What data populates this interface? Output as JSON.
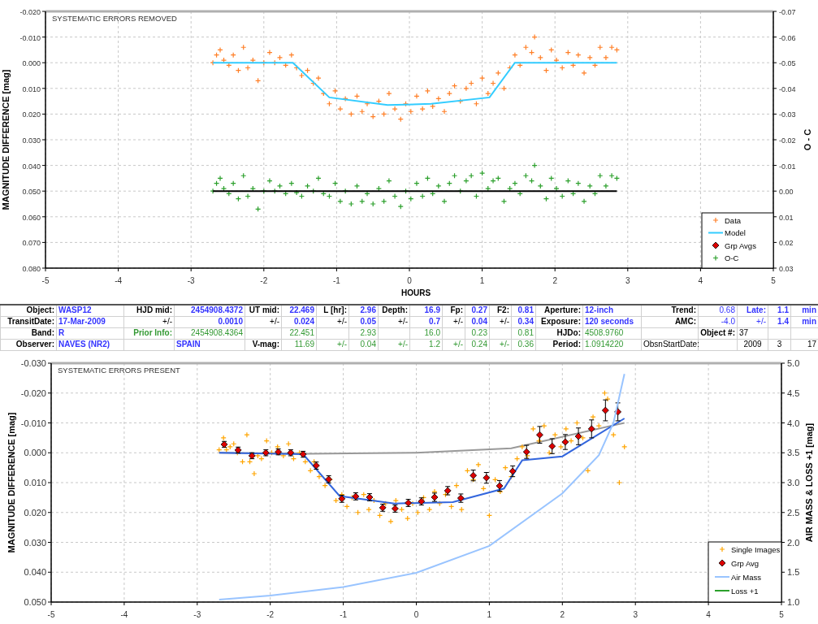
{
  "top_chart": {
    "chart_data": {
      "type": "scatter",
      "title": "SYSTEMATIC ERRORS REMOVED",
      "xlabel": "HOURS",
      "ylabel": "MAGNITUDE DIFFERENCE [mag]",
      "y2label": "O - C",
      "xlim": [
        -5,
        5
      ],
      "ylim": [
        0.08,
        -0.02
      ],
      "y2lim": [
        0.03,
        -0.07
      ],
      "grid": true,
      "legend": true,
      "xticks": [
        {
          "value": -5,
          "label": "-5"
        },
        {
          "value": -4,
          "label": "-4"
        },
        {
          "value": -3,
          "label": "-3"
        },
        {
          "value": -2,
          "label": "-2"
        },
        {
          "value": -1,
          "label": "-1"
        },
        {
          "value": 0,
          "label": "0"
        },
        {
          "value": 1,
          "label": "1"
        },
        {
          "value": 2,
          "label": "2"
        },
        {
          "value": 3,
          "label": "3"
        },
        {
          "value": 4,
          "label": "4"
        },
        {
          "value": 5,
          "label": "5"
        }
      ],
      "yticks": [
        {
          "value": -0.02,
          "label": "-0.020"
        },
        {
          "value": -0.01,
          "label": "-0.010"
        },
        {
          "value": 0,
          "label": "0.000"
        },
        {
          "value": 0.01,
          "label": "0.010"
        },
        {
          "value": 0.02,
          "label": "0.020"
        },
        {
          "value": 0.03,
          "label": "0.030"
        },
        {
          "value": 0.04,
          "label": "0.040"
        },
        {
          "value": 0.05,
          "label": "0.050"
        },
        {
          "value": 0.06,
          "label": "0.060"
        },
        {
          "value": 0.07,
          "label": "0.070"
        },
        {
          "value": 0.08,
          "label": "0.080"
        }
      ],
      "y2ticks": [
        {
          "value": -0.07,
          "label": "-0.07"
        },
        {
          "value": -0.06,
          "label": "-0.06"
        },
        {
          "value": -0.05,
          "label": "-0.05"
        },
        {
          "value": -0.04,
          "label": "-0.04"
        },
        {
          "value": -0.03,
          "label": "-0.03"
        },
        {
          "value": -0.02,
          "label": "-0.02"
        },
        {
          "value": -0.01,
          "label": "-0.01"
        },
        {
          "value": 0,
          "label": "0.00"
        },
        {
          "value": 0.01,
          "label": "0.01"
        },
        {
          "value": 0.02,
          "label": "0.02"
        },
        {
          "value": 0.03,
          "label": "0.03"
        }
      ],
      "series": [
        {
          "name": "Data",
          "type": "scatter",
          "marker": "plus",
          "color": "#ff7f27",
          "x": [
            -2.7,
            -2.65,
            -2.6,
            -2.55,
            -2.48,
            -2.42,
            -2.35,
            -2.28,
            -2.22,
            -2.15,
            -2.08,
            -2.0,
            -1.92,
            -1.85,
            -1.78,
            -1.7,
            -1.62,
            -1.55,
            -1.48,
            -1.4,
            -1.32,
            -1.25,
            -1.18,
            -1.1,
            -1.02,
            -0.95,
            -0.88,
            -0.8,
            -0.72,
            -0.65,
            -0.58,
            -0.5,
            -0.42,
            -0.35,
            -0.28,
            -0.2,
            -0.12,
            -0.05,
            0.02,
            0.1,
            0.18,
            0.25,
            0.32,
            0.4,
            0.48,
            0.55,
            0.62,
            0.7,
            0.78,
            0.85,
            0.92,
            1.0,
            1.08,
            1.15,
            1.22,
            1.3,
            1.38,
            1.45,
            1.52,
            1.6,
            1.68,
            1.72,
            1.8,
            1.88,
            1.95,
            2.02,
            2.1,
            2.18,
            2.25,
            2.32,
            2.4,
            2.48,
            2.55,
            2.62,
            2.7,
            2.78,
            2.85
          ],
          "values": [
            0.0,
            -0.003,
            -0.005,
            -0.001,
            0.001,
            -0.003,
            0.003,
            -0.006,
            0.002,
            -0.001,
            0.007,
            0.0,
            -0.004,
            0.0,
            -0.002,
            0.001,
            -0.003,
            0.002,
            0.005,
            0.003,
            0.008,
            0.006,
            0.012,
            0.016,
            0.011,
            0.018,
            0.014,
            0.02,
            0.013,
            0.019,
            0.016,
            0.021,
            0.015,
            0.02,
            0.012,
            0.018,
            0.022,
            0.016,
            0.019,
            0.013,
            0.018,
            0.011,
            0.017,
            0.014,
            0.019,
            0.012,
            0.009,
            0.015,
            0.01,
            0.008,
            0.016,
            0.006,
            0.012,
            0.008,
            0.004,
            0.01,
            0.002,
            -0.003,
            0.001,
            -0.006,
            -0.004,
            -0.01,
            -0.002,
            0.003,
            -0.005,
            -0.001,
            0.002,
            -0.004,
            0.001,
            -0.003,
            0.004,
            -0.002,
            0.001,
            -0.006,
            -0.002,
            -0.006,
            -0.005
          ]
        },
        {
          "name": "Model",
          "type": "line",
          "color": "#33ccff",
          "x": [
            -2.7,
            -1.6,
            -1.1,
            -0.3,
            0.3,
            1.1,
            1.45,
            2.85
          ],
          "values": [
            0,
            0,
            0.0135,
            0.0165,
            0.016,
            0.0135,
            0,
            0
          ]
        },
        {
          "name": "Grp Avgs",
          "type": "scatter",
          "marker": "diamond",
          "color": "#dd0000"
        },
        {
          "name": "O-C",
          "type": "scatter",
          "marker": "plus",
          "color": "#2ca02c",
          "axis": "y2",
          "x": [
            -2.7,
            -2.65,
            -2.6,
            -2.55,
            -2.48,
            -2.42,
            -2.35,
            -2.28,
            -2.22,
            -2.15,
            -2.08,
            -2.0,
            -1.92,
            -1.85,
            -1.78,
            -1.7,
            -1.62,
            -1.55,
            -1.48,
            -1.4,
            -1.32,
            -1.25,
            -1.18,
            -1.1,
            -1.02,
            -0.95,
            -0.88,
            -0.8,
            -0.72,
            -0.65,
            -0.58,
            -0.5,
            -0.42,
            -0.35,
            -0.28,
            -0.2,
            -0.12,
            -0.05,
            0.02,
            0.1,
            0.18,
            0.25,
            0.32,
            0.4,
            0.48,
            0.55,
            0.62,
            0.7,
            0.78,
            0.85,
            0.92,
            1.0,
            1.08,
            1.15,
            1.22,
            1.3,
            1.38,
            1.45,
            1.52,
            1.6,
            1.68,
            1.72,
            1.8,
            1.88,
            1.95,
            2.02,
            2.1,
            2.18,
            2.25,
            2.32,
            2.4,
            2.48,
            2.55,
            2.62,
            2.7,
            2.78,
            2.85
          ],
          "values": [
            0.0,
            -0.003,
            -0.005,
            -0.001,
            0.001,
            -0.003,
            0.003,
            -0.006,
            0.002,
            -0.001,
            0.007,
            0.0,
            -0.004,
            0.0,
            -0.002,
            0.001,
            -0.003,
            0.0006,
            0.002,
            -0.002,
            0.0,
            -0.005,
            0.001,
            0.002,
            -0.003,
            0.004,
            0.0,
            0.005,
            -0.002,
            0.004,
            0.001,
            0.005,
            -0.001,
            0.004,
            -0.004,
            0.002,
            0.006,
            0.0,
            0.003,
            -0.003,
            0.002,
            -0.005,
            0.001,
            -0.002,
            0.004,
            -0.003,
            -0.006,
            0.0,
            -0.004,
            -0.006,
            0.002,
            -0.007,
            -0.001,
            -0.004,
            -0.005,
            0.004,
            -0.001,
            -0.003,
            0.001,
            -0.006,
            -0.004,
            -0.01,
            -0.002,
            0.003,
            -0.005,
            -0.001,
            0.002,
            -0.004,
            0.001,
            -0.003,
            0.004,
            -0.002,
            0.001,
            -0.006,
            -0.002,
            -0.006,
            -0.005
          ]
        },
        {
          "type": "line",
          "color": "#000000",
          "axis": "y2",
          "x": [
            -2.7,
            2.85
          ],
          "values": [
            0,
            0
          ]
        }
      ]
    }
  },
  "parameters_table": {
    "rows": [
      [
        {
          "text": "Object:",
          "kind": "label"
        },
        {
          "text": "WASP12",
          "kind": "text"
        },
        {
          "text": "HJD mid:",
          "kind": "label"
        },
        {
          "text": "2454908.4372",
          "kind": "number"
        },
        {
          "text": "UT mid:",
          "kind": "label"
        },
        {
          "text": "22.469",
          "kind": "number"
        },
        {
          "text": "L [hr]:",
          "kind": "label"
        },
        {
          "text": "2.96",
          "kind": "number"
        },
        {
          "text": "Depth:",
          "kind": "label"
        },
        {
          "text": "16.9",
          "kind": "number"
        },
        {
          "text": "Fp:",
          "kind": "label"
        },
        {
          "text": "0.27",
          "kind": "number"
        },
        {
          "text": "F2:",
          "kind": "label"
        },
        {
          "text": "0.81",
          "kind": "number"
        },
        {
          "text": "Aperture:",
          "kind": "label"
        },
        {
          "text": "12-inch",
          "kind": "text"
        },
        {
          "text": "Trend:",
          "kind": "label"
        },
        {
          "text": "0.68",
          "kind": "number-plain"
        },
        {
          "text": "Late:",
          "kind": "number"
        },
        {
          "text": "1.1",
          "kind": "number"
        },
        {
          "text": "min",
          "kind": "number"
        }
      ],
      [
        {
          "text": "TransitDate:",
          "kind": "label"
        },
        {
          "text": "17-Mar-2009",
          "kind": "text"
        },
        {
          "text": "+/-",
          "kind": "plain"
        },
        {
          "text": "0.0010",
          "kind": "number"
        },
        {
          "text": "+/-",
          "kind": "plain"
        },
        {
          "text": "0.024",
          "kind": "number"
        },
        {
          "text": "+/-",
          "kind": "plain"
        },
        {
          "text": "0.05",
          "kind": "number"
        },
        {
          "text": "+/-",
          "kind": "plain"
        },
        {
          "text": "0.7",
          "kind": "number"
        },
        {
          "text": "+/-",
          "kind": "plain"
        },
        {
          "text": "0.04",
          "kind": "number"
        },
        {
          "text": "+/-",
          "kind": "plain"
        },
        {
          "text": "0.34",
          "kind": "number"
        },
        {
          "text": "Exposure:",
          "kind": "label"
        },
        {
          "text": "120 seconds",
          "kind": "text"
        },
        {
          "text": "AMC:",
          "kind": "label"
        },
        {
          "text": "-4.0",
          "kind": "number-plain"
        },
        {
          "text": "+/-",
          "kind": "number-plain"
        },
        {
          "text": "1.4",
          "kind": "number"
        },
        {
          "text": "min",
          "kind": "number"
        }
      ],
      [
        {
          "text": "Band:",
          "kind": "label"
        },
        {
          "text": "R",
          "kind": "text"
        },
        {
          "text": "Prior Info:",
          "kind": "prior-label"
        },
        {
          "text": "2454908.4364",
          "kind": "prior"
        },
        null,
        {
          "text": "22.451",
          "kind": "prior"
        },
        null,
        {
          "text": "2.93",
          "kind": "prior"
        },
        null,
        {
          "text": "16.0",
          "kind": "prior"
        },
        null,
        {
          "text": "0.23",
          "kind": "prior"
        },
        null,
        {
          "text": "0.81",
          "kind": "prior"
        },
        {
          "text": "HJDo:",
          "kind": "label"
        },
        {
          "text": "4508.9760",
          "kind": "prior-text"
        },
        null,
        {
          "text": "Object #:",
          "kind": "label"
        },
        {
          "text": "37",
          "kind": "plain-text"
        },
        null,
        null
      ],
      [
        {
          "text": "Observer:",
          "kind": "label"
        },
        {
          "text": "NAVES (NR2)",
          "kind": "text"
        },
        null,
        {
          "text": "SPAIN",
          "kind": "text"
        },
        {
          "text": "V-mag:",
          "kind": "label"
        },
        {
          "text": "11.69",
          "kind": "prior"
        },
        {
          "text": "+/-",
          "kind": "prior"
        },
        {
          "text": "0.04",
          "kind": "prior"
        },
        {
          "text": "+/-",
          "kind": "prior"
        },
        {
          "text": "1.2",
          "kind": "prior"
        },
        {
          "text": "+/-",
          "kind": "prior"
        },
        {
          "text": "0.24",
          "kind": "prior"
        },
        {
          "text": "+/-",
          "kind": "prior"
        },
        {
          "text": "0.36",
          "kind": "prior"
        },
        {
          "text": "Period:",
          "kind": "label"
        },
        {
          "text": "1.0914220",
          "kind": "prior-text"
        },
        {
          "text": "ObsnStartDate:",
          "kind": "plain"
        },
        null,
        {
          "text": "2009",
          "kind": "plain-center"
        },
        {
          "text": "3",
          "kind": "plain-center"
        },
        {
          "text": "17",
          "kind": "plain"
        }
      ]
    ]
  },
  "bottom_chart": {
    "chart_data": {
      "type": "scatter",
      "title": "SYSTEMATIC ERRORS PRESENT",
      "ylabel": "MAGNITUDE DIFFERENCE [mag]",
      "y2label": "AIR MASS & LOSS +1 [mag]",
      "xlim": [
        -5,
        5
      ],
      "ylim": [
        0.05,
        -0.03
      ],
      "y2lim": [
        1,
        5
      ],
      "grid": true,
      "legend": true,
      "xticks": [
        {
          "value": -5,
          "label": "-5"
        },
        {
          "value": -4,
          "label": "-4"
        },
        {
          "value": -3,
          "label": "-3"
        },
        {
          "value": -2,
          "label": "-2"
        },
        {
          "value": -1,
          "label": "-1"
        },
        {
          "value": 0,
          "label": "0"
        },
        {
          "value": 1,
          "label": "1"
        },
        {
          "value": 2,
          "label": "2"
        },
        {
          "value": 3,
          "label": "3"
        },
        {
          "value": 4,
          "label": "4"
        },
        {
          "value": 5,
          "label": "5"
        }
      ],
      "yticks": [
        {
          "value": -0.03,
          "label": "-0.030"
        },
        {
          "value": -0.02,
          "label": "-0.020"
        },
        {
          "value": -0.01,
          "label": "-0.010"
        },
        {
          "value": 0,
          "label": "0.000"
        },
        {
          "value": 0.01,
          "label": "0.010"
        },
        {
          "value": 0.02,
          "label": "0.020"
        },
        {
          "value": 0.03,
          "label": "0.030"
        },
        {
          "value": 0.04,
          "label": "0.040"
        },
        {
          "value": 0.05,
          "label": "0.050"
        }
      ],
      "y2ticks": [
        {
          "value": 5,
          "label": "5.0"
        },
        {
          "value": 4.5,
          "label": "4.5"
        },
        {
          "value": 4,
          "label": "4.0"
        },
        {
          "value": 3.5,
          "label": "3.5"
        },
        {
          "value": 3,
          "label": "3.0"
        },
        {
          "value": 2.5,
          "label": "2.5"
        },
        {
          "value": 2,
          "label": "2.0"
        },
        {
          "value": 1.5,
          "label": "1.5"
        },
        {
          "value": 1,
          "label": "1.0"
        }
      ],
      "series": [
        {
          "type": "line",
          "color": "#999999",
          "x": [
            -2.7,
            -1.5,
            0,
            1.3,
            2.85
          ],
          "values": [
            0,
            0.0003,
            0,
            -0.0015,
            -0.01
          ]
        },
        {
          "name": "Single Images",
          "type": "scatter",
          "marker": "plus",
          "color": "#ffa500",
          "x": [
            -2.7,
            -2.64,
            -2.6,
            -2.55,
            -2.5,
            -2.45,
            -2.38,
            -2.32,
            -2.28,
            -2.22,
            -2.17,
            -2.12,
            -2.05,
            -1.98,
            -1.9,
            -1.82,
            -1.75,
            -1.68,
            -1.6,
            -1.52,
            -1.45,
            -1.4,
            -1.33,
            -1.25,
            -1.18,
            -1.1,
            -1.02,
            -0.95,
            -0.88,
            -0.8,
            -0.72,
            -0.65,
            -0.58,
            -0.5,
            -0.42,
            -0.35,
            -0.28,
            -0.2,
            -0.12,
            -0.05,
            0.02,
            0.1,
            0.18,
            0.25,
            0.32,
            0.4,
            0.48,
            0.55,
            0.62,
            0.7,
            0.78,
            0.85,
            0.92,
            1.0,
            1.08,
            1.15,
            1.22,
            1.3,
            1.38,
            1.45,
            1.52,
            1.6,
            1.68,
            1.75,
            1.82,
            1.9,
            1.98,
            2.05,
            2.12,
            2.2,
            2.28,
            2.35,
            2.42,
            2.5,
            2.58,
            2.62,
            2.7,
            2.78,
            2.85
          ],
          "values": [
            -0.001,
            -0.005,
            -0.001,
            -0.002,
            -0.003,
            0.0,
            0.003,
            -0.006,
            0.003,
            0.007,
            0.001,
            0.002,
            -0.004,
            0.0,
            -0.002,
            0.001,
            -0.003,
            0.002,
            0.0,
            0.003,
            0.006,
            0.003,
            0.008,
            0.011,
            0.009,
            0.016,
            0.014,
            0.018,
            0.015,
            0.02,
            0.014,
            0.019,
            0.016,
            0.021,
            0.017,
            0.023,
            0.016,
            0.019,
            0.022,
            0.017,
            0.02,
            0.015,
            0.019,
            0.013,
            0.017,
            0.014,
            0.018,
            0.011,
            0.019,
            0.006,
            0.009,
            0.004,
            0.012,
            0.021,
            0.009,
            0.013,
            0.005,
            0.008,
            0.002,
            -0.002,
            0.001,
            -0.008,
            -0.004,
            -0.009,
            0.0,
            -0.006,
            -0.002,
            -0.008,
            -0.004,
            -0.01,
            -0.005,
            0.006,
            -0.012,
            -0.009,
            -0.02,
            -0.018,
            -0.006,
            0.01,
            -0.002
          ]
        },
        {
          "type": "line",
          "color": "#3366dd",
          "x": [
            -2.7,
            -1.55,
            -1.05,
            -0.3,
            0.5,
            1.2,
            1.45,
            2.0,
            2.85
          ],
          "values": [
            0,
            0.0005,
            0.0145,
            0.017,
            0.0165,
            0.012,
            0.0025,
            0.0012,
            -0.0115
          ]
        },
        {
          "name": "Grp Avg",
          "type": "scatter",
          "marker": "diamond",
          "color": "#dd0000",
          "x": [
            -2.63,
            -2.44,
            -2.25,
            -2.06,
            -1.89,
            -1.72,
            -1.55,
            -1.37,
            -1.2,
            -1.02,
            -0.83,
            -0.64,
            -0.46,
            -0.29,
            -0.11,
            0.07,
            0.25,
            0.43,
            0.61,
            0.78,
            0.96,
            1.14,
            1.32,
            1.51,
            1.69,
            1.86,
            2.04,
            2.22,
            2.4,
            2.59,
            2.76
          ],
          "values": [
            -0.0028,
            -0.0009,
            0.001,
            0.0,
            -0.0003,
            0.0,
            0.0005,
            0.0043,
            0.0089,
            0.0154,
            0.0146,
            0.0149,
            0.0184,
            0.0187,
            0.0168,
            0.0163,
            0.0149,
            0.0127,
            0.0152,
            0.0076,
            0.0084,
            0.0111,
            0.0062,
            -0.0003,
            -0.006,
            -0.0022,
            -0.0036,
            -0.0055,
            -0.008,
            -0.0142,
            -0.0137
          ],
          "errors": [
            0.001,
            0.001,
            0.001,
            0.001,
            0.001,
            0.001,
            0.001,
            0.0012,
            0.0012,
            0.0012,
            0.0012,
            0.0012,
            0.0012,
            0.0012,
            0.0012,
            0.0012,
            0.0014,
            0.0014,
            0.0014,
            0.0018,
            0.0018,
            0.0018,
            0.0018,
            0.0022,
            0.0028,
            0.0025,
            0.0025,
            0.0028,
            0.003,
            0.0035,
            0.003
          ]
        },
        {
          "name": "Air Mass",
          "type": "line",
          "color": "#99c4ff",
          "axis": "y2",
          "x": [
            -2.7,
            -2,
            -1,
            0,
            1,
            2,
            2.5,
            2.7,
            2.85
          ],
          "values": [
            1.04,
            1.11,
            1.25,
            1.49,
            1.94,
            2.82,
            3.46,
            4.0,
            4.82
          ]
        },
        {
          "name": "Loss +1",
          "type": "line",
          "color": "#2ca02c",
          "axis": "y2"
        }
      ]
    }
  }
}
